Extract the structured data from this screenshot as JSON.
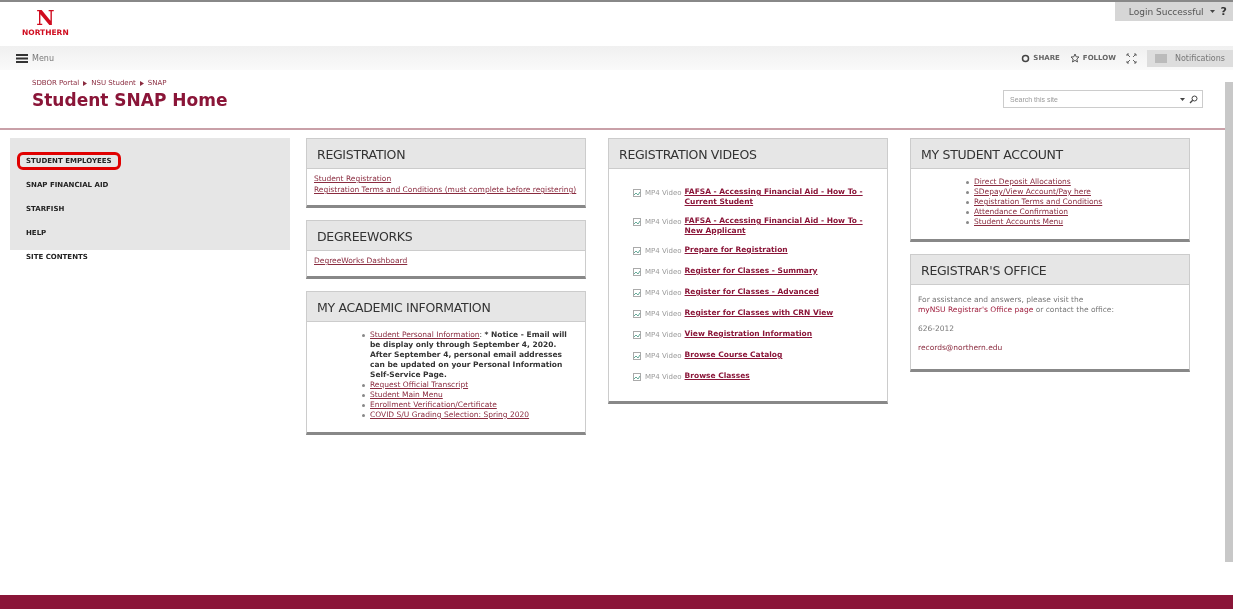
{
  "logo": {
    "letter": "N",
    "caption": "NORTHERN"
  },
  "top_bar": {
    "login": "Login Successful",
    "help": "?"
  },
  "menu_bar": {
    "menu": "Menu",
    "share": "SHARE",
    "follow": "FOLLOW",
    "notifications": "Notifications"
  },
  "breadcrumb": [
    "SDBOR Portal",
    "NSU Student",
    "SNAP"
  ],
  "page_title": "Student SNAP Home",
  "search": {
    "placeholder": "Search this site"
  },
  "sidebar": {
    "items": [
      {
        "label": "STUDENT EMPLOYEES",
        "highlighted": true
      },
      {
        "label": "SNAP FINANCIAL AID",
        "highlighted": false
      },
      {
        "label": "STARFISH",
        "highlighted": false
      },
      {
        "label": "HELP",
        "highlighted": false
      },
      {
        "label": "SITE CONTENTS",
        "highlighted": false
      }
    ]
  },
  "columns": [
    [
      {
        "title": "REGISTRATION",
        "kind": "links",
        "links": [
          "Student Registration",
          "Registration Terms and Conditions (must complete before registering)"
        ]
      },
      {
        "title": "DEGREEWORKS",
        "kind": "links",
        "links": [
          "DegreeWorks Dashboard"
        ]
      },
      {
        "title": "MY ACADEMIC INFORMATION",
        "kind": "bullets",
        "items": [
          {
            "link": "Student Personal Information",
            "separator": ":",
            "note": "* Notice - Email will be display only through September 4, 2020.  After September 4, personal email addresses can be updated on your Personal Information Self-Service Page."
          },
          {
            "link": "Request Official Transcript"
          },
          {
            "link": "Student Main Menu"
          },
          {
            "link": "Enrollment Verification/Certificate"
          },
          {
            "link": "COVID S/U Grading Selection: Spring 2020"
          }
        ]
      }
    ],
    [
      {
        "title": "REGISTRATION VIDEOS",
        "kind": "videos",
        "videos": [
          {
            "alt": "MP4 Video",
            "link": "FAFSA - Accessing Financial Aid - How To - Current Student"
          },
          {
            "alt": "MP4 Video",
            "link": "FAFSA - Accessing Financial Aid - How To - New Applicant"
          },
          {
            "alt": "MP4 Video",
            "link": "Prepare for Registration"
          },
          {
            "alt": "MP4 Video",
            "link": "Register for Classes - Summary"
          },
          {
            "alt": "MP4 Video",
            "link": "Register for Classes - Advanced"
          },
          {
            "alt": "MP4 Video",
            "link": "Register for Classes with CRN View"
          },
          {
            "alt": "MP4 Video",
            "link": "View Registration Information"
          },
          {
            "alt": "MP4 Video",
            "link": "Browse Course Catalog"
          },
          {
            "alt": "MP4 Video",
            "link": "Browse Classes"
          }
        ]
      }
    ],
    [
      {
        "title": "MY STUDENT ACCOUNT",
        "kind": "bullets",
        "items": [
          {
            "link": "Direct Deposit Allocations"
          },
          {
            "link": "SDepay/View Account/Pay here"
          },
          {
            "link": "Registration Terms and Conditions"
          },
          {
            "link": "Attendance Confirmation"
          },
          {
            "link": "Student Accounts Menu"
          }
        ]
      },
      {
        "title": "REGISTRAR'S OFFICE",
        "kind": "contact",
        "intro": "For assistance and answers, please visit the",
        "intro_link": "myNSU Registrar's Office page",
        "intro_end": "or contact the office:",
        "phone": "626-2012",
        "email": "records@northern.edu"
      }
    ]
  ]
}
